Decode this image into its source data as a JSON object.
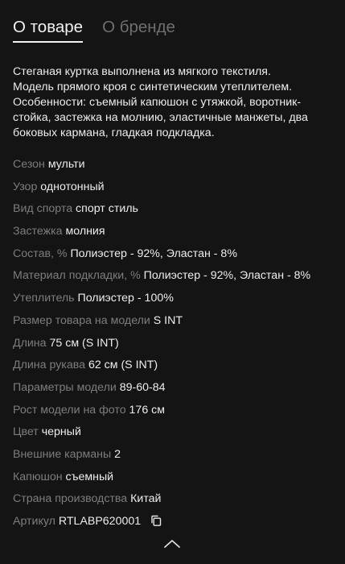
{
  "tabs": {
    "about_product": "О товаре",
    "about_brand": "О бренде"
  },
  "description": "Стеганая куртка выполнена из мягкого текстиля.\nМодель прямого кроя с синтетическим утеплителем.\nОсобенности: съемный капюшон с утяжкой, воротник-\nстойка, застежка на молнию, эластичные манжеты, два\nбоковых кармана, гладкая подкладка.",
  "properties": [
    {
      "label": "Сезон",
      "value": "мульти"
    },
    {
      "label": "Узор",
      "value": "однотонный"
    },
    {
      "label": "Вид спорта",
      "value": "спорт стиль"
    },
    {
      "label": "Застежка",
      "value": "молния"
    },
    {
      "label": "Состав, %",
      "value": "Полиэстер - 92%, Эластан - 8%"
    },
    {
      "label": "Материал подкладки, %",
      "value": "Полиэстер - 92%, Эластан - 8%"
    },
    {
      "label": "Утеплитель",
      "value": "Полиэстер - 100%"
    },
    {
      "label": "Размер товара на модели",
      "value": "S INT"
    },
    {
      "label": "Длина",
      "value": "75 см (S INT)"
    },
    {
      "label": "Длина рукава",
      "value": "62 см (S INT)"
    },
    {
      "label": "Параметры модели",
      "value": "89-60-84"
    },
    {
      "label": "Рост модели на фото",
      "value": "176 см"
    },
    {
      "label": "Цвет",
      "value": "черный"
    },
    {
      "label": "Внешние карманы",
      "value": "2"
    },
    {
      "label": "Капюшон",
      "value": "съемный"
    },
    {
      "label": "Страна производства",
      "value": "Китай"
    },
    {
      "label": "Артикул",
      "value": "RTLABP620001"
    }
  ],
  "icons": {
    "copy": "copy-icon",
    "collapse": "chevron-up-icon"
  },
  "colors": {
    "background": "#141414",
    "text": "#ededed",
    "label": "#7d7d7d",
    "inactive_tab": "#6f6f6f"
  }
}
